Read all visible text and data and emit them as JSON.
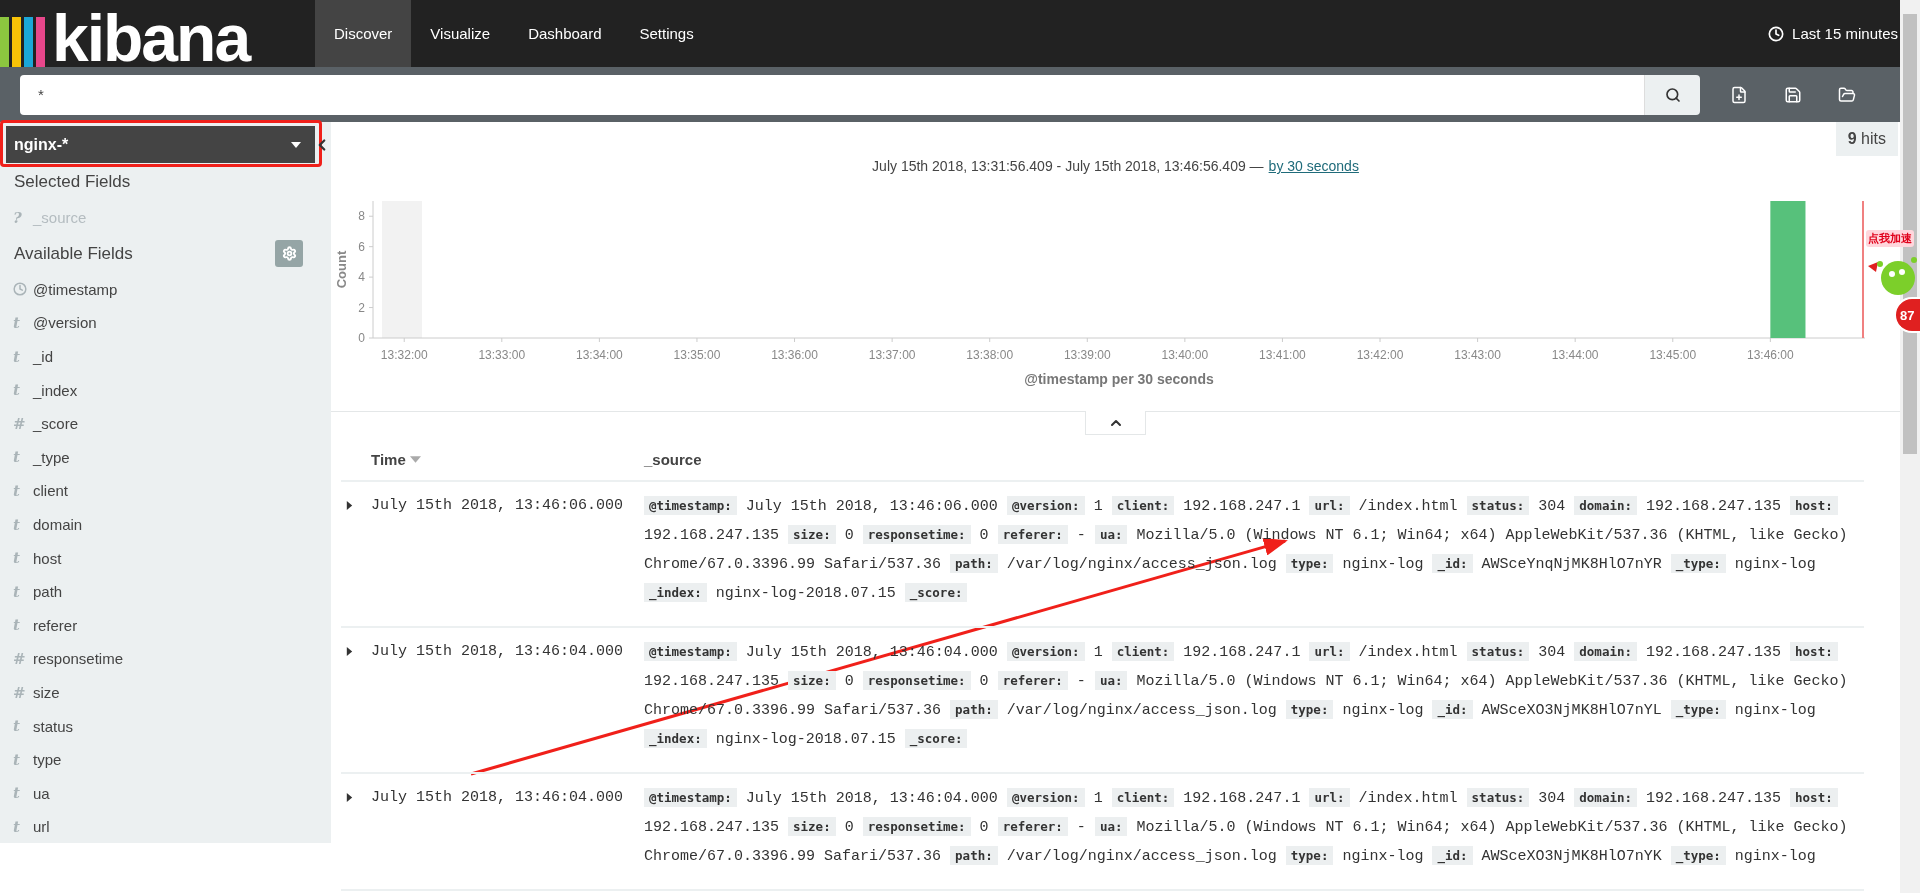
{
  "nav": {
    "logo": "kibana",
    "tabs": [
      {
        "label": "Discover",
        "selected": true
      },
      {
        "label": "Visualize",
        "selected": false
      },
      {
        "label": "Dashboard",
        "selected": false
      },
      {
        "label": "Settings",
        "selected": false
      }
    ],
    "time_picker": "Last 15 minutes"
  },
  "search": {
    "value": "*"
  },
  "sidebar": {
    "index_pattern": "nginx-*",
    "selected_heading": "Selected Fields",
    "selected_fields": [
      {
        "kind": "unknown",
        "symbol": "?",
        "name": "_source"
      }
    ],
    "available_heading": "Available Fields",
    "available_fields": [
      {
        "kind": "date",
        "name": "@timestamp"
      },
      {
        "kind": "string",
        "symbol": "t",
        "name": "@version"
      },
      {
        "kind": "string",
        "symbol": "t",
        "name": "_id"
      },
      {
        "kind": "string",
        "symbol": "t",
        "name": "_index"
      },
      {
        "kind": "number",
        "symbol": "#",
        "name": "_score"
      },
      {
        "kind": "string",
        "symbol": "t",
        "name": "_type"
      },
      {
        "kind": "string",
        "symbol": "t",
        "name": "client"
      },
      {
        "kind": "string",
        "symbol": "t",
        "name": "domain"
      },
      {
        "kind": "string",
        "symbol": "t",
        "name": "host"
      },
      {
        "kind": "string",
        "symbol": "t",
        "name": "path"
      },
      {
        "kind": "string",
        "symbol": "t",
        "name": "referer"
      },
      {
        "kind": "number",
        "symbol": "#",
        "name": "responsetime"
      },
      {
        "kind": "number",
        "symbol": "#",
        "name": "size"
      },
      {
        "kind": "string",
        "symbol": "t",
        "name": "status"
      },
      {
        "kind": "string",
        "symbol": "t",
        "name": "type"
      },
      {
        "kind": "string",
        "symbol": "t",
        "name": "ua"
      },
      {
        "kind": "string",
        "symbol": "t",
        "name": "url"
      }
    ]
  },
  "hits": "**9** hits",
  "histogram": {
    "range": "July 15th 2018, 13:31:56.409 - July 15th 2018, 13:46:56.409 —",
    "interval_link": "by 30 seconds",
    "chart_data": {
      "type": "bar",
      "xlabel": "@timestamp per 30 seconds",
      "ylabel": "Count",
      "categories": [
        "13:32:00",
        null,
        "13:33:00",
        null,
        "13:34:00",
        null,
        "13:35:00",
        null,
        "13:36:00",
        null,
        "13:37:00",
        null,
        "13:38:00",
        null,
        "13:39:00",
        null,
        "13:40:00",
        null,
        "13:41:00",
        null,
        "13:42:00",
        null,
        "13:43:00",
        null,
        "13:44:00",
        null,
        "13:45:00",
        null,
        "13:46:00",
        null
      ],
      "series": [
        {
          "color": "#57c17b",
          "values": [
            null,
            null,
            null,
            null,
            null,
            null,
            null,
            null,
            null,
            null,
            null,
            null,
            null,
            null,
            null,
            null,
            null,
            null,
            null,
            null,
            null,
            null,
            null,
            null,
            null,
            null,
            null,
            null,
            9,
            null
          ]
        }
      ],
      "ylim": [
        0,
        9
      ],
      "yticks": [
        0,
        2,
        4,
        6,
        8
      ]
    }
  },
  "table": {
    "columns": [
      {
        "label": "Time",
        "sortable": true
      },
      {
        "label": "_source",
        "sortable": false
      }
    ],
    "rows": [
      {
        "time": "July 15th 2018, 13:46:06.000",
        "fields": [
          {
            "key": "@timestamp:",
            "value": "July 15th 2018, 13:46:06.000"
          },
          {
            "key": "@version:",
            "value": "1"
          },
          {
            "key": "client:",
            "value": "192.168.247.1"
          },
          {
            "key": "url:",
            "value": "/index.html"
          },
          {
            "key": "status:",
            "value": "304"
          },
          {
            "key": "domain:",
            "value": "192.168.247.135"
          },
          {
            "key": "host:",
            "value": "192.168.247.135"
          },
          {
            "key": "size:",
            "value": "0"
          },
          {
            "key": "responsetime:",
            "value": "0"
          },
          {
            "key": "referer:",
            "value": "-"
          },
          {
            "key": "ua:",
            "value": "Mozilla/5.0 (Windows NT 6.1; Win64; x64) AppleWebKit/537.36 (KHTML, like Gecko) Chrome/67.0.3396.99 Safari/537.36"
          },
          {
            "key": "path:",
            "value": "/var/log/nginx/access_json.log"
          },
          {
            "key": "type:",
            "value": "nginx-log"
          },
          {
            "key": "_id:",
            "value": "AWSceYnqNjMK8HlO7nYR"
          },
          {
            "key": "_type:",
            "value": "nginx-log"
          },
          {
            "key": "_index:",
            "value": "nginx-log-2018.07.15"
          },
          {
            "key": "_score:"
          }
        ]
      },
      {
        "time": "July 15th 2018, 13:46:04.000",
        "fields": [
          {
            "key": "@timestamp:",
            "value": "July 15th 2018, 13:46:04.000"
          },
          {
            "key": "@version:",
            "value": "1"
          },
          {
            "key": "client:",
            "value": "192.168.247.1"
          },
          {
            "key": "url:",
            "value": "/index.html"
          },
          {
            "key": "status:",
            "value": "304"
          },
          {
            "key": "domain:",
            "value": "192.168.247.135"
          },
          {
            "key": "host:",
            "value": "192.168.247.135"
          },
          {
            "key": "size:",
            "value": "0"
          },
          {
            "key": "responsetime:",
            "value": "0"
          },
          {
            "key": "referer:",
            "value": "-"
          },
          {
            "key": "ua:",
            "value": "Mozilla/5.0 (Windows NT 6.1; Win64; x64) AppleWebKit/537.36 (KHTML, like Gecko) Chrome/67.0.3396.99 Safari/537.36"
          },
          {
            "key": "path:",
            "value": "/var/log/nginx/access_json.log"
          },
          {
            "key": "type:",
            "value": "nginx-log"
          },
          {
            "key": "_id:",
            "value": "AWSceXO3NjMK8HlO7nYL"
          },
          {
            "key": "_type:",
            "value": "nginx-log"
          },
          {
            "key": "_index:",
            "value": "nginx-log-2018.07.15"
          },
          {
            "key": "_score:"
          }
        ]
      },
      {
        "time": "July 15th 2018, 13:46:04.000",
        "fields": [
          {
            "key": "@timestamp:",
            "value": "July 15th 2018, 13:46:04.000"
          },
          {
            "key": "@version:",
            "value": "1"
          },
          {
            "key": "client:",
            "value": "192.168.247.1"
          },
          {
            "key": "url:",
            "value": "/index.html"
          },
          {
            "key": "status:",
            "value": "304"
          },
          {
            "key": "domain:",
            "value": "192.168.247.135"
          },
          {
            "key": "host:",
            "value": "192.168.247.135"
          },
          {
            "key": "size:",
            "value": "0"
          },
          {
            "key": "responsetime:",
            "value": "0"
          },
          {
            "key": "referer:",
            "value": "-"
          },
          {
            "key": "ua:",
            "value": "Mozilla/5.0 (Windows NT 6.1; Win64; x64) AppleWebKit/537.36 (KHTML, like Gecko) Chrome/67.0.3396.99 Safari/537.36"
          },
          {
            "key": "path:",
            "value": "/var/log/nginx/access_json.log"
          },
          {
            "key": "type:",
            "value": "nginx-log"
          },
          {
            "key": "_id:",
            "value": "AWSceXO3NjMK8HlO7nYK"
          },
          {
            "key": "_type:",
            "value": "nginx-log"
          }
        ]
      }
    ]
  },
  "widget": {
    "label": "点我加速",
    "badge": "87"
  }
}
